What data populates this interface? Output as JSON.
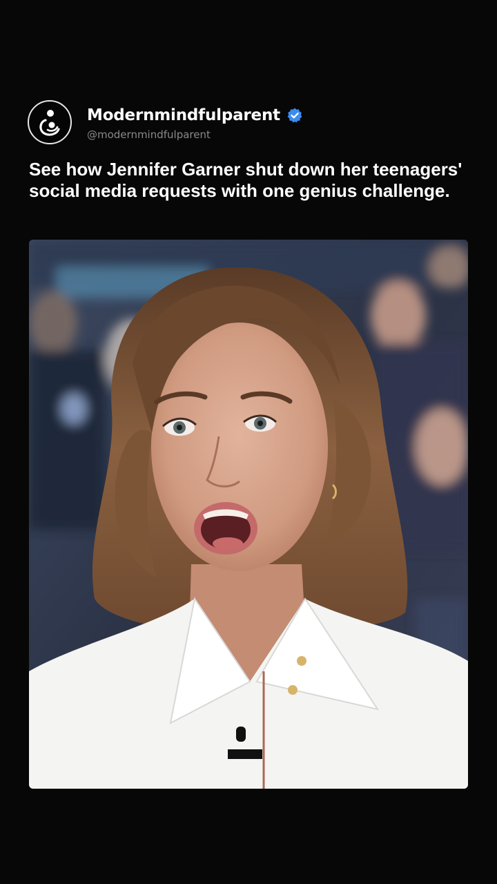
{
  "account": {
    "display_name": "Modernmindfulparent",
    "handle": "@modernmindfulparent",
    "verified": true,
    "avatar_icon": "parent-child-logo-icon",
    "verified_icon": "verified-badge-icon"
  },
  "post": {
    "caption": "See how Jennifer Garner shut down her teenagers' social media requests with one genius challenge."
  },
  "colors": {
    "background": "#070707",
    "verified_blue": "#3b8cf0",
    "handle_gray": "#8a8a8a"
  }
}
